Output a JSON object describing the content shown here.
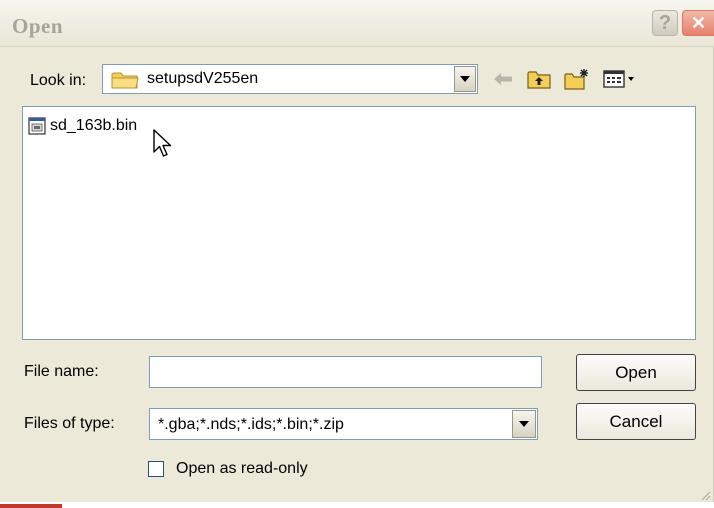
{
  "window": {
    "title": "Open",
    "help_label": "?",
    "close_label": "✕"
  },
  "toolbar": {
    "look_in_label": "Look in:",
    "look_in_value": "setupsdV255en",
    "icons": [
      "back-arrow-icon",
      "up-folder-icon",
      "new-folder-icon",
      "view-menu-icon"
    ]
  },
  "file_list": {
    "items": [
      {
        "name": "sd_163b.bin",
        "icon": "binary-file-icon"
      }
    ]
  },
  "form": {
    "file_name_label": "File name:",
    "file_name_value": "",
    "files_of_type_label": "Files of type:",
    "files_of_type_value": "*.gba;*.nds;*.ids;*.bin;*.zip",
    "read_only_label": "Open as read-only",
    "read_only_checked": false
  },
  "buttons": {
    "open_label": "Open",
    "cancel_label": "Cancel"
  },
  "colors": {
    "dialog_bg": "#ece9d8",
    "field_border": "#7f9db9",
    "folder_yellow": "#f3cf5a",
    "close_red": "#e6806c"
  }
}
